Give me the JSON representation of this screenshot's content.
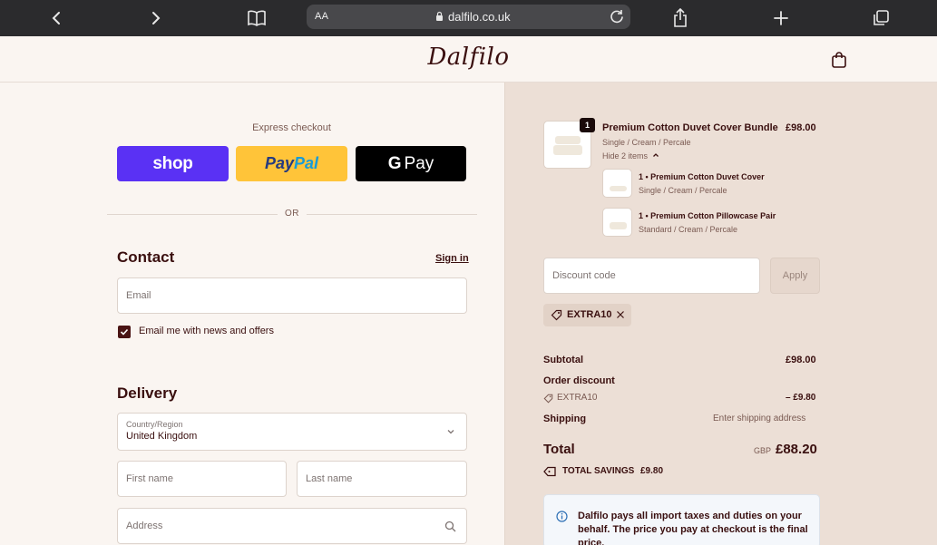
{
  "browser": {
    "text_size_label": "AA",
    "url": "dalfilo.co.uk"
  },
  "header": {
    "logo": "Dalfilo"
  },
  "checkout": {
    "express_label": "Express checkout",
    "shop_label": "shop",
    "paypal_part1": "Pay",
    "paypal_part2": "Pal",
    "gpay_g": "G",
    "gpay_label": "Pay",
    "or_label": "OR",
    "contact": {
      "heading": "Contact",
      "sign_in": "Sign in",
      "email_placeholder": "Email",
      "newsletter_label": "Email me with news and offers"
    },
    "delivery": {
      "heading": "Delivery",
      "country_label": "Country/Region",
      "country_value": "United Kingdom",
      "first_name_placeholder": "First name",
      "last_name_placeholder": "Last name",
      "address_placeholder": "Address"
    }
  },
  "summary": {
    "item": {
      "quantity": "1",
      "name": "Premium Cotton Duvet Cover Bundle",
      "price": "£98.00",
      "variant": "Single / Cream / Percale",
      "toggle": "Hide 2 items"
    },
    "sub_items": [
      {
        "name": "1 • Premium Cotton Duvet Cover",
        "variant": "Single / Cream / Percale"
      },
      {
        "name": "1 • Premium Cotton Pillowcase Pair",
        "variant": "Standard / Cream / Percale"
      }
    ],
    "discount_placeholder": "Discount code",
    "apply_label": "Apply",
    "applied_code": "EXTRA10",
    "subtotal_label": "Subtotal",
    "subtotal_value": "£98.00",
    "order_discount_label": "Order discount",
    "discount_code": "EXTRA10",
    "discount_value": "– £9.80",
    "shipping_label": "Shipping",
    "shipping_value": "Enter shipping address",
    "total_label": "Total",
    "currency": "GBP",
    "total_value": "£88.20",
    "savings_label": "TOTAL SAVINGS",
    "savings_value": "£9.80",
    "info_text": "Dalfilo pays all import taxes and duties on your behalf. The price you pay at checkout is the final price."
  }
}
